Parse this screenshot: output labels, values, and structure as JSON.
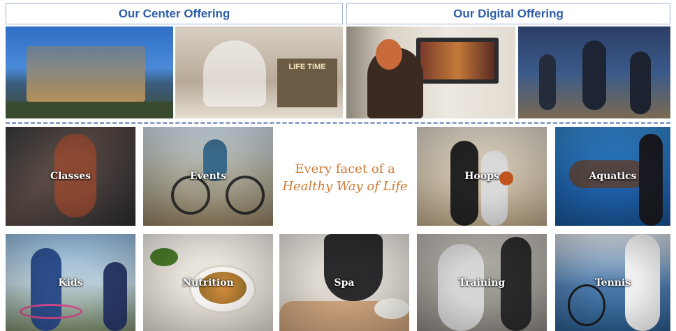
{
  "headers": {
    "center": "Our Center Offering",
    "digital": "Our Digital Offering"
  },
  "top_photos": {
    "center_building": "",
    "center_lobby_sign": "LIFE TIME",
    "digital_home": "",
    "digital_studio": ""
  },
  "tagline": {
    "line1": "Every facet of a",
    "line2": "Healthy Way of Life"
  },
  "tiles": {
    "classes": "Classes",
    "events": "Events",
    "hoops": "Hoops",
    "aquatics": "Aquatics",
    "kids": "Kids",
    "nutrition": "Nutrition",
    "spa": "Spa",
    "training": "Training",
    "tennis": "Tennis"
  }
}
